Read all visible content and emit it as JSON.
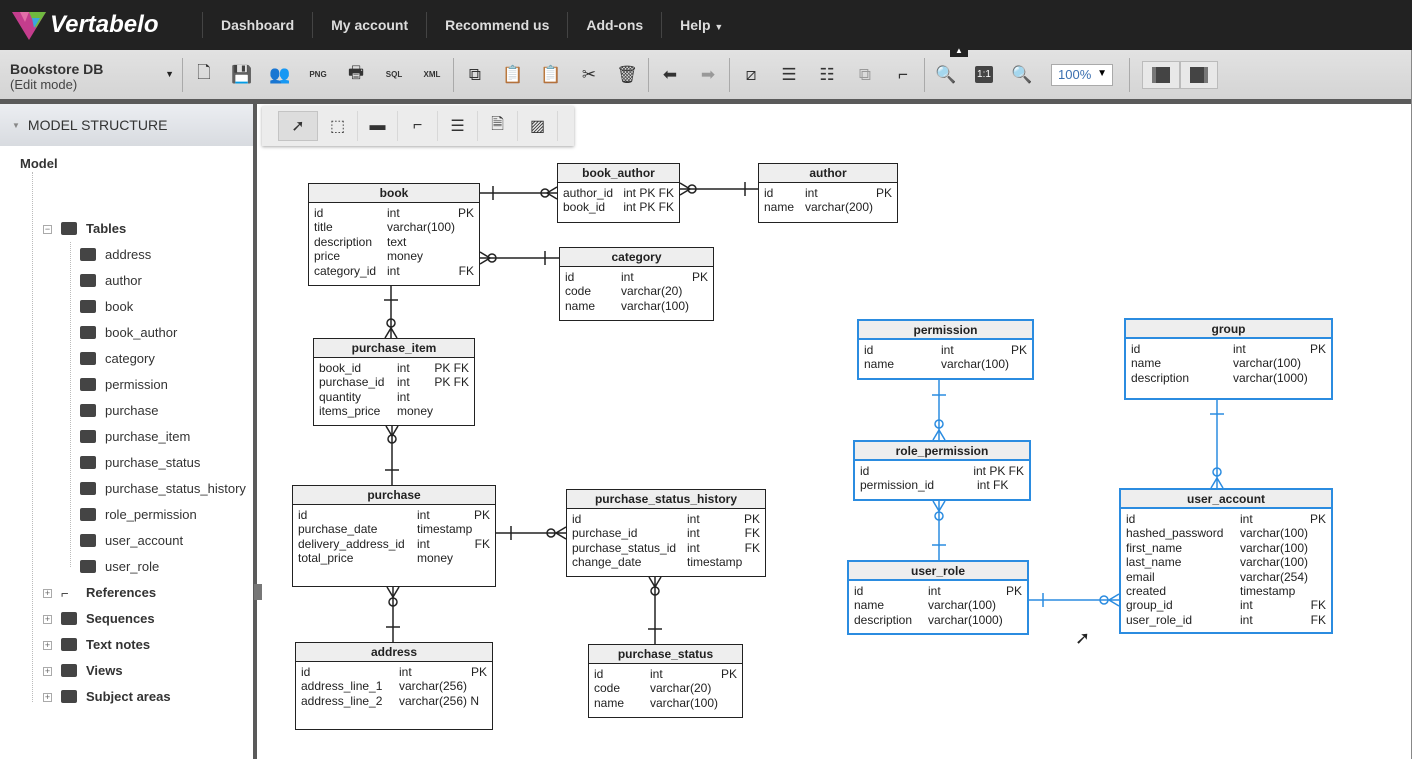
{
  "app": {
    "logo": "Vertabelo",
    "nav": [
      "Dashboard",
      "My account",
      "Recommend us",
      "Add-ons",
      "Help"
    ]
  },
  "model": {
    "name": "Bookstore DB",
    "mode": "(Edit mode)"
  },
  "toolbar": {
    "buttons": [
      "new-document",
      "save",
      "share",
      "export-png",
      "print",
      "export-sql",
      "export-xml",
      "copy",
      "paste",
      "paste-format",
      "cut",
      "delete",
      "undo",
      "redo",
      "edit-style",
      "align",
      "distribute",
      "arrange",
      "line-style",
      "zoom-out",
      "zoom-reset",
      "zoom-in"
    ],
    "zoom_reset_label": "1:1",
    "zoom": "100%"
  },
  "sidebar": {
    "title": "MODEL STRUCTURE",
    "root": "Model",
    "tables_label": "Tables",
    "tables": [
      "address",
      "author",
      "book",
      "book_author",
      "category",
      "permission",
      "purchase",
      "purchase_item",
      "purchase_status",
      "purchase_status_history",
      "role_permission",
      "user_account",
      "user_role"
    ],
    "groups": [
      "References",
      "Sequences",
      "Text notes",
      "Views",
      "Subject areas"
    ]
  },
  "palette": [
    "select",
    "rectangle-select",
    "add-table",
    "add-reference",
    "add-view",
    "add-note",
    "add-area"
  ],
  "colors": {
    "selected": "#2b8ce0",
    "topbar": "#222222"
  },
  "entities": [
    {
      "name": "book",
      "rows": [
        [
          "id",
          "int",
          "PK"
        ],
        [
          "title",
          "varchar(100)",
          ""
        ],
        [
          "description",
          "text",
          ""
        ],
        [
          "price",
          "money",
          ""
        ],
        [
          "category_id",
          "int",
          "FK"
        ]
      ]
    },
    {
      "name": "book_author",
      "rows": [
        [
          "author_id",
          "int PK FK",
          ""
        ],
        [
          "book_id",
          "int PK FK",
          ""
        ]
      ]
    },
    {
      "name": "author",
      "rows": [
        [
          "id",
          "int",
          "PK"
        ],
        [
          "name",
          "varchar(200)",
          ""
        ]
      ]
    },
    {
      "name": "category",
      "rows": [
        [
          "id",
          "int",
          "PK"
        ],
        [
          "code",
          "varchar(20)",
          ""
        ],
        [
          "name",
          "varchar(100)",
          ""
        ]
      ]
    },
    {
      "name": "purchase_item",
      "rows": [
        [
          "book_id",
          "int",
          "PK FK"
        ],
        [
          "purchase_id",
          "int",
          "PK FK"
        ],
        [
          "quantity",
          "int",
          ""
        ],
        [
          "items_price",
          "money",
          ""
        ]
      ]
    },
    {
      "name": "purchase",
      "rows": [
        [
          "id",
          "int",
          "PK"
        ],
        [
          "purchase_date",
          "timestamp",
          ""
        ],
        [
          "delivery_address_id",
          "int",
          "FK"
        ],
        [
          "total_price",
          "money",
          ""
        ]
      ]
    },
    {
      "name": "purchase_status_history",
      "rows": [
        [
          "id",
          "int",
          "PK"
        ],
        [
          "purchase_id",
          "int",
          "FK"
        ],
        [
          "purchase_status_id",
          "int",
          "FK"
        ],
        [
          "change_date",
          "timestamp",
          ""
        ]
      ]
    },
    {
      "name": "address",
      "rows": [
        [
          "id",
          "int",
          "PK"
        ],
        [
          "address_line_1",
          "varchar(256)",
          ""
        ],
        [
          "address_line_2",
          "varchar(256) N",
          ""
        ]
      ]
    },
    {
      "name": "purchase_status",
      "rows": [
        [
          "id",
          "int",
          "PK"
        ],
        [
          "code",
          "varchar(20)",
          ""
        ],
        [
          "name",
          "varchar(100)",
          ""
        ]
      ]
    },
    {
      "name": "permission",
      "rows": [
        [
          "id",
          "int",
          "PK"
        ],
        [
          "name",
          "varchar(100)",
          ""
        ]
      ]
    },
    {
      "name": "group",
      "rows": [
        [
          "id",
          "int",
          "PK"
        ],
        [
          "name",
          "varchar(100)",
          ""
        ],
        [
          "description",
          "varchar(1000)",
          ""
        ]
      ]
    },
    {
      "name": "role_permission",
      "rows": [
        [
          "id",
          "int PK FK",
          ""
        ],
        [
          "permission_id",
          "int FK",
          ""
        ]
      ]
    },
    {
      "name": "user_account",
      "rows": [
        [
          "id",
          "int",
          "PK"
        ],
        [
          "hashed_password",
          "varchar(100)",
          ""
        ],
        [
          "first_name",
          "varchar(100)",
          ""
        ],
        [
          "last_name",
          "varchar(100)",
          ""
        ],
        [
          "email",
          "varchar(254)",
          ""
        ],
        [
          "created",
          "timestamp",
          ""
        ],
        [
          "group_id",
          "int",
          "FK"
        ],
        [
          "user_role_id",
          "int",
          "FK"
        ]
      ]
    },
    {
      "name": "user_role",
      "rows": [
        [
          "id",
          "int",
          "PK"
        ],
        [
          "name",
          "varchar(100)",
          ""
        ],
        [
          "description",
          "varchar(1000)",
          ""
        ]
      ]
    }
  ]
}
